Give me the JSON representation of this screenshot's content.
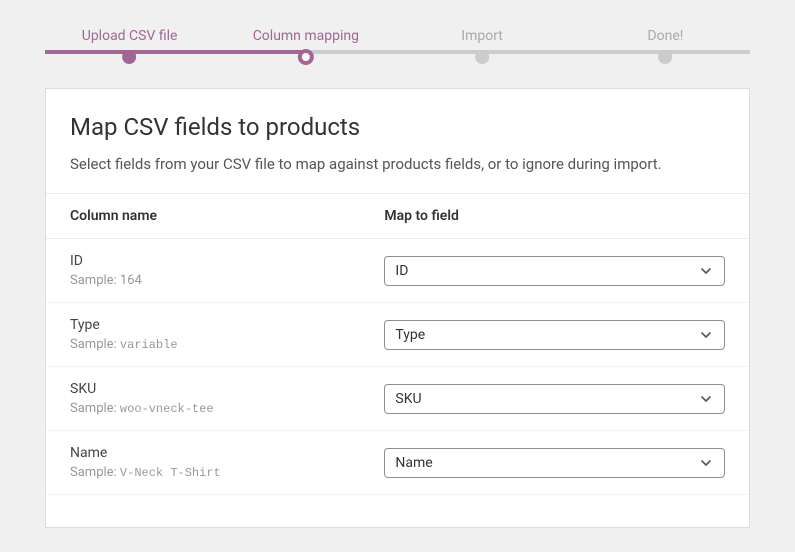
{
  "steps": [
    {
      "label": "Upload CSV file"
    },
    {
      "label": "Column mapping"
    },
    {
      "label": "Import"
    },
    {
      "label": "Done!"
    }
  ],
  "page": {
    "title": "Map CSV fields to products",
    "subtitle": "Select fields from your CSV file to map against products fields, or to ignore during import."
  },
  "headers": {
    "column_name": "Column name",
    "map_to_field": "Map to field"
  },
  "sample_prefix": "Sample: ",
  "rows": [
    {
      "name": "ID",
      "sample": "164",
      "mono": false,
      "select": "ID"
    },
    {
      "name": "Type",
      "sample": "variable",
      "mono": true,
      "select": "Type"
    },
    {
      "name": "SKU",
      "sample": "woo-vneck-tee",
      "mono": true,
      "select": "SKU"
    },
    {
      "name": "Name",
      "sample": "V-Neck T-Shirt",
      "mono": true,
      "select": "Name"
    }
  ]
}
